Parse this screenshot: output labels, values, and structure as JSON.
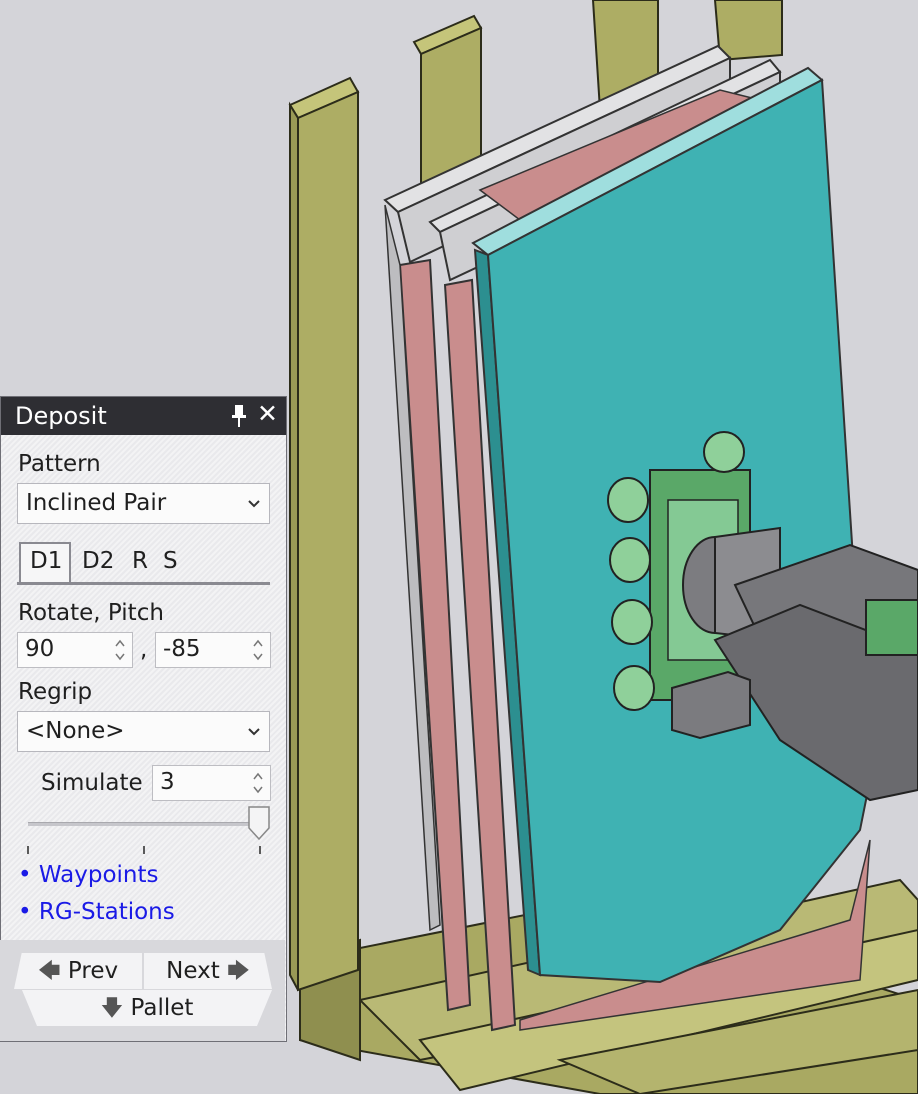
{
  "panel": {
    "title": "Deposit",
    "pattern": {
      "label": "Pattern",
      "value": "Inclined Pair"
    },
    "tabs": [
      {
        "label": "D1",
        "active": true
      },
      {
        "label": "D2",
        "active": false
      },
      {
        "label": "R",
        "active": false
      },
      {
        "label": "S",
        "active": false
      }
    ],
    "rotate_pitch": {
      "label": "Rotate, Pitch",
      "rotate": "90",
      "separator": ",",
      "pitch": "-85"
    },
    "regrip": {
      "label": "Regrip",
      "value": "<None>"
    },
    "simulate": {
      "label": "Simulate",
      "value": "3",
      "slider_level": 1.0
    },
    "links": [
      "Waypoints",
      "RG-Stations"
    ],
    "nav": {
      "prev": "Prev",
      "next": "Next",
      "pallet": "Pallet"
    }
  },
  "colors": {
    "background": "#d4d4d9",
    "panel_header": "#2e2e33",
    "link": "#1a1ae6",
    "frame": "#a6a65c",
    "pallet": "#b8b870",
    "teal_panel": "#3fb2b3",
    "pink_panel": "#c98d8d",
    "grey_frame": "#c9c9cd",
    "gripper": "#7fc38b",
    "robot_arm": "#6a6a6e"
  },
  "icons": {
    "pin": "pin-icon",
    "close": "close-icon",
    "dropdown": "chevron-down-icon"
  }
}
